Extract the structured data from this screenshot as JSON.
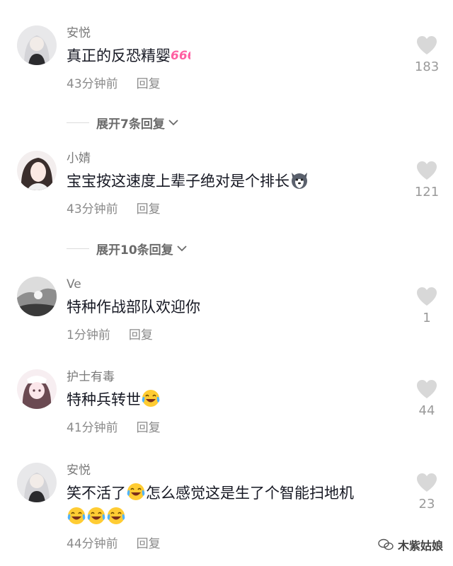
{
  "comments": [
    {
      "username": "安悦",
      "text": "真正的反恐精婴",
      "emoji": "666-icon",
      "time": "43分钟前",
      "reply": "回复",
      "likes": "183"
    },
    {
      "username": "小婧",
      "text": "宝宝按这速度上辈子绝对是个排长",
      "emoji": "husky-icon",
      "time": "43分钟前",
      "reply": "回复",
      "likes": "121"
    },
    {
      "username": "Ve",
      "text": "特种作战部队欢迎你",
      "time": "1分钟前",
      "reply": "回复",
      "likes": "1"
    },
    {
      "username": "护士有毒",
      "text": "特种兵转世",
      "emoji": "laugh-cry-icon",
      "time": "41分钟前",
      "reply": "回复",
      "likes": "44"
    },
    {
      "username": "安悦",
      "text_part1": "笑不活了",
      "text_part2": "怎么感觉这是生了个智能扫地机",
      "emoji": "laugh-cry-icon",
      "time": "44分钟前",
      "reply": "回复",
      "likes": "23"
    }
  ],
  "expanders": [
    {
      "label": "展开7条回复"
    },
    {
      "label": "展开10条回复"
    }
  ],
  "watermark": {
    "text": "木紫姑娘",
    "icon": "wechat-icon"
  },
  "colors": {
    "text": "#161823",
    "meta": "#8a8a8a",
    "heart": "#d8d8d8"
  }
}
